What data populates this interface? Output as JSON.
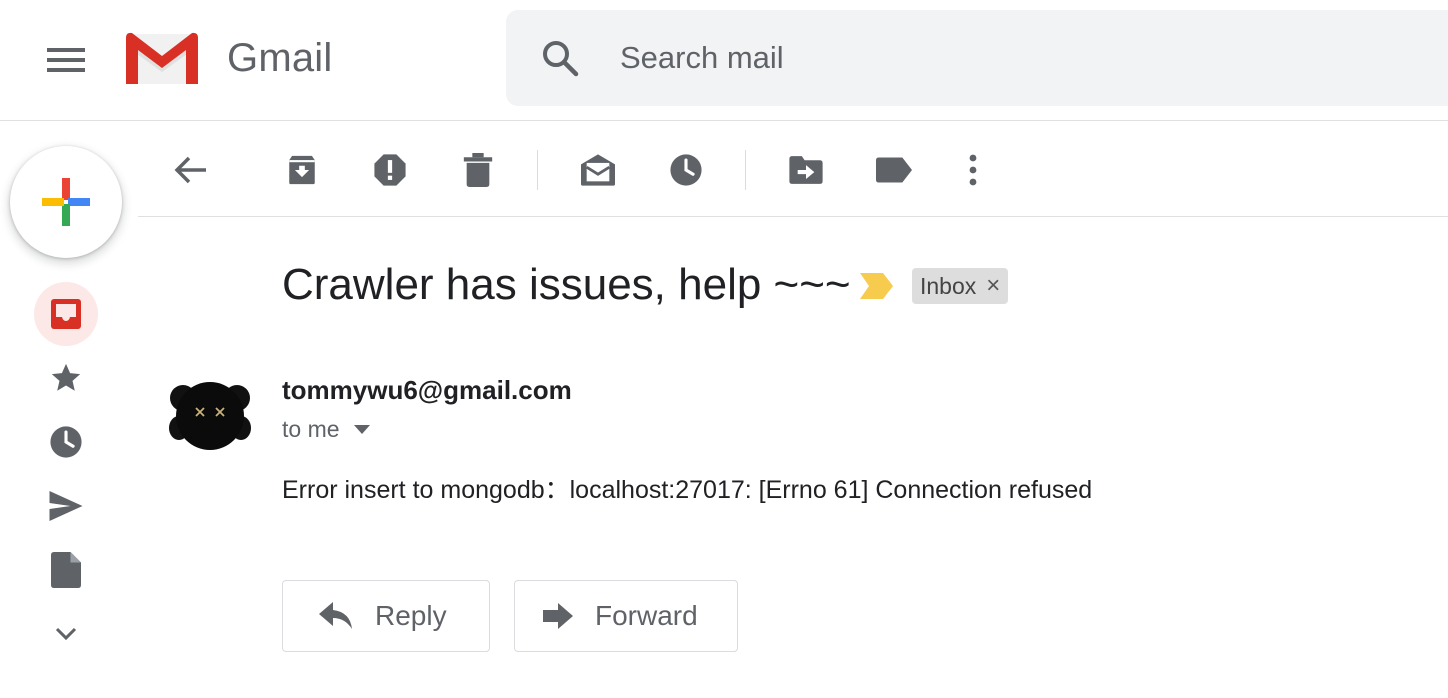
{
  "header": {
    "app_name": "Gmail",
    "search_placeholder": "Search mail"
  },
  "message": {
    "subject": "Crawler has issues, help ~~~",
    "label": "Inbox",
    "label_close": "×",
    "sender": "tommywu6@gmail.com",
    "recipient_text": "to me",
    "body": "Error insert to mongodb：localhost:27017: [Errno 61] Connection refused"
  },
  "actions": {
    "reply": "Reply",
    "forward": "Forward"
  },
  "icons": {
    "menu": "menu-icon",
    "search": "search-icon",
    "compose": "compose-plus-icon",
    "back": "back-arrow-icon",
    "archive": "archive-icon",
    "spam": "report-spam-icon",
    "delete": "trash-icon",
    "mark_unread": "mark-unread-icon",
    "snooze": "snooze-clock-icon",
    "move": "move-to-icon",
    "labels": "label-icon",
    "more": "more-vert-icon",
    "importance": "importance-marker-icon"
  },
  "colors": {
    "gmail_red": "#d93025",
    "importance_yellow": "#f7cb4d",
    "icon_gray": "#5f6368",
    "search_bg": "#f1f3f4",
    "active_rail_bg": "#fce8e6"
  }
}
